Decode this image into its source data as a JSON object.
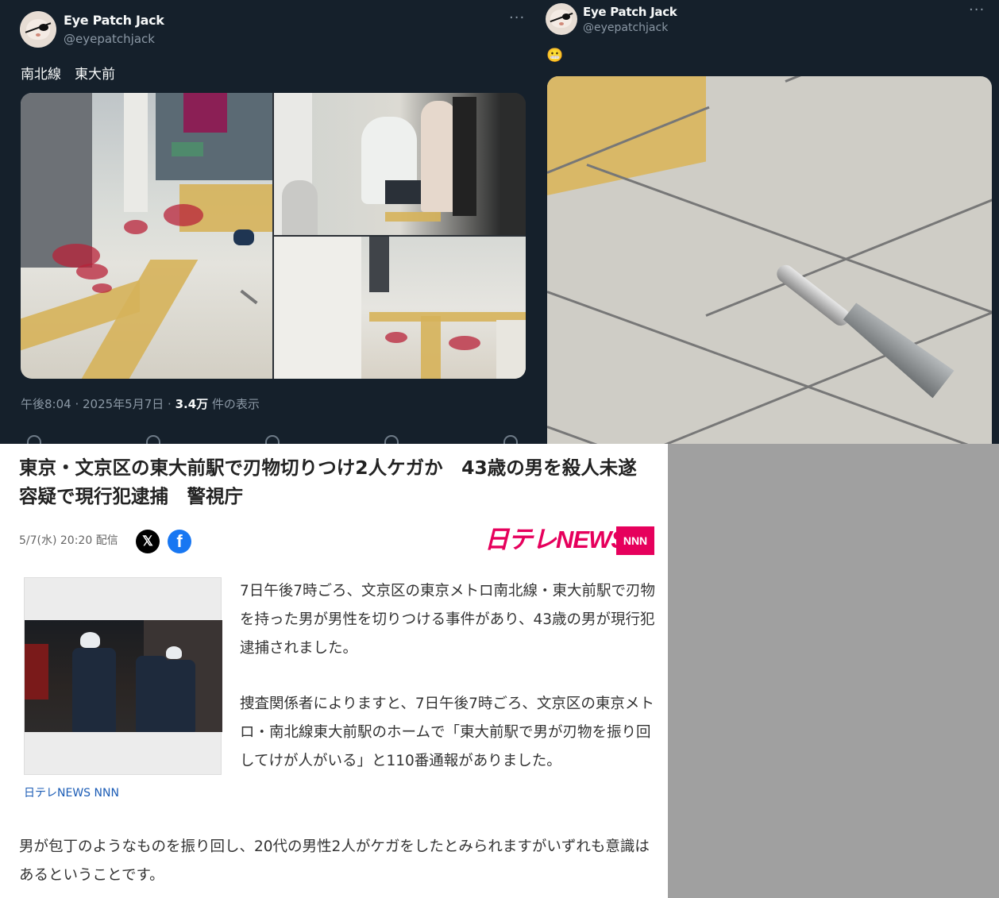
{
  "tweets": [
    {
      "display_name": "Eye Patch Jack",
      "handle": "@eyepatchjack",
      "more": "···",
      "text": "南北線　東大前",
      "time": "午後8:04 · 2025年5月7日 · ",
      "views_count": "3.4万",
      "views_label": " 件の表示",
      "photos": [
        "station-platform-blood-photo",
        "people-kneeling-photo",
        "platform-floor-photo"
      ]
    },
    {
      "display_name": "Eye Patch Jack",
      "handle": "@eyepatchjack",
      "more": "···",
      "text": "😬",
      "photos": [
        "knife-on-floor-photo"
      ]
    }
  ],
  "article": {
    "headline": "東京・文京区の東大前駅で刃物切りつけ2人ケガか　43歳の男を殺人未遂容疑で現行犯逮捕　警視庁",
    "date": "5/7(水) 20:20 配信",
    "share": {
      "x_label": "𝕏",
      "facebook_label": "f"
    },
    "logo_text": "日テレNEWS",
    "logo_badge": "NNN",
    "image_caption": "日テレNEWS NNN",
    "paragraphs": [
      "7日午後7時ごろ、文京区の東京メトロ南北線・東大前駅で刃物を持った男が男性を切りつける事件があり、43歳の男が現行犯逮捕されました。",
      "捜査関係者によりますと、7日午後7時ごろ、文京区の東京メトロ・南北線東大前駅のホームで「東大前駅で男が刃物を振り回してけが人がいる」と110番通報がありました。",
      "男が包丁のようなものを振り回し、20代の男性2人がケガをしたとみられますがいずれも意識はあるということです。"
    ]
  },
  "colors": {
    "tweet_bg": "#15202b",
    "secondary_text": "#8b98a5",
    "ntv_pink": "#e6005c",
    "facebook_blue": "#1877f2",
    "caption_link": "#1a5bb5",
    "page_bg": "#a0a0a0"
  }
}
